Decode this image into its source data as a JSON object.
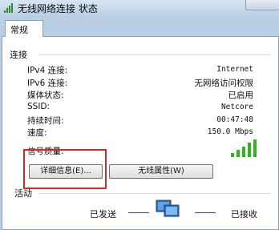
{
  "window": {
    "title": "无线网络连接 状态"
  },
  "tabs": [
    {
      "label": "常规"
    }
  ],
  "connection": {
    "header": "连接",
    "rows": [
      {
        "label": "IPv4 连接:",
        "value": "Internet"
      },
      {
        "label": "IPv6 连接:",
        "value": "无网络访问权限"
      },
      {
        "label": "媒体状态:",
        "value": "已启用"
      },
      {
        "label": "SSID:",
        "value": "Netcore"
      },
      {
        "label": "持续时间:",
        "value": "00:47:48"
      },
      {
        "label": "速度:",
        "value": "150.0 Mbps"
      }
    ],
    "signal_label": "信号质量:",
    "signal_icon": "signal-bars-icon",
    "signal_bars_lit": 5
  },
  "buttons": {
    "details": "详细信息(E)...",
    "wireless_props": "无线属性(W)"
  },
  "activity": {
    "header": "活动",
    "sent": "已发送",
    "received": "已接收",
    "icon": "network-monitor-icon"
  },
  "colors": {
    "highlight": "#d02a2a",
    "signal_green": "#2fb31f"
  }
}
